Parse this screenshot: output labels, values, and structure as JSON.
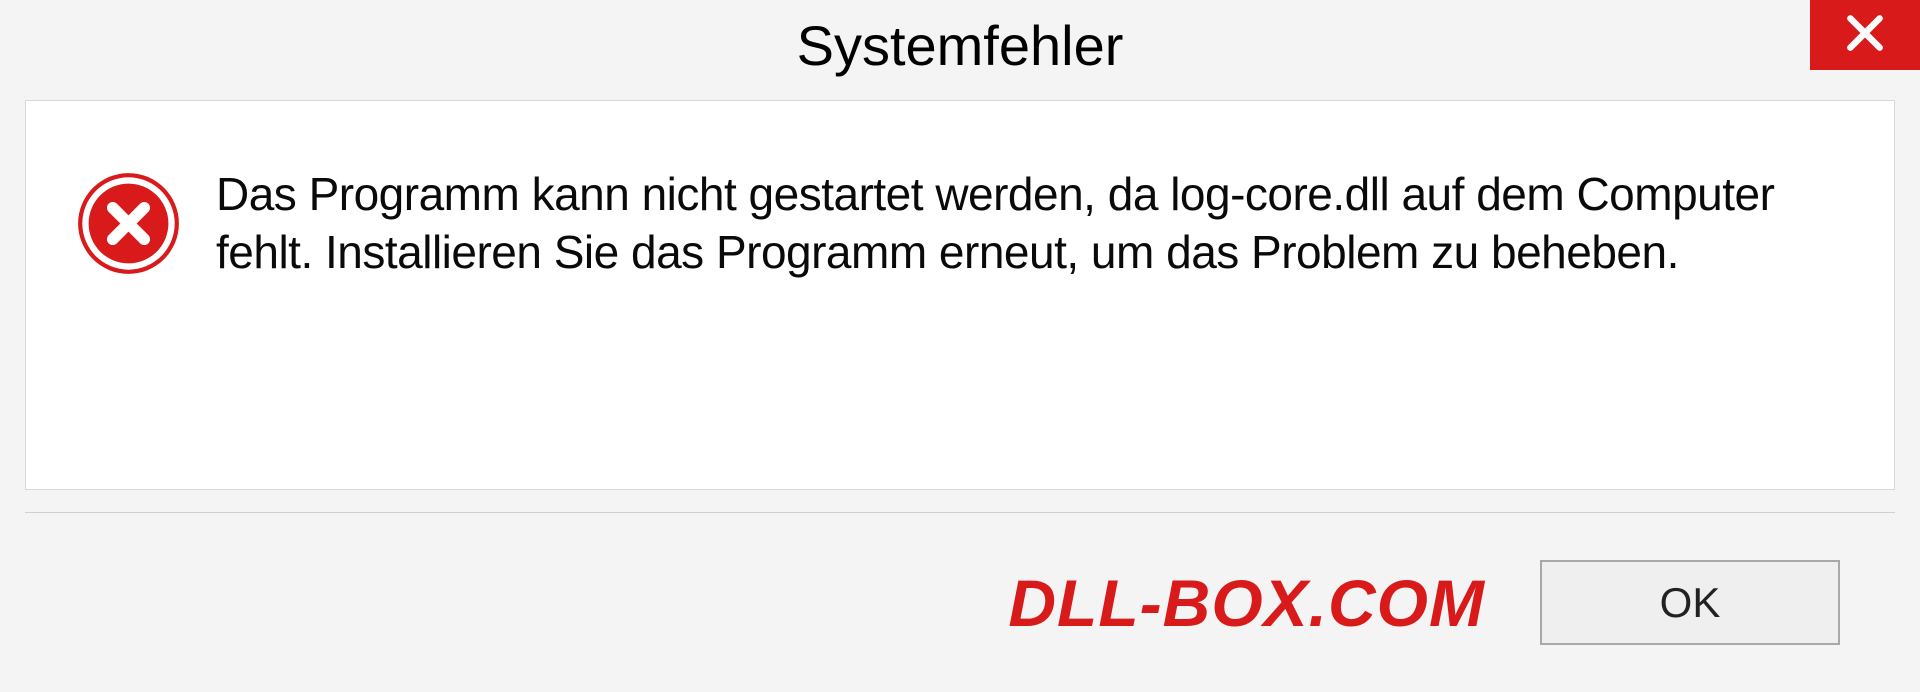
{
  "dialog": {
    "title": "Systemfehler",
    "message": "Das Programm kann nicht gestartet werden, da log-core.dll auf dem Computer fehlt. Installieren Sie das Programm erneut, um das Problem zu beheben.",
    "ok_label": "OK",
    "watermark": "DLL-BOX.COM"
  }
}
